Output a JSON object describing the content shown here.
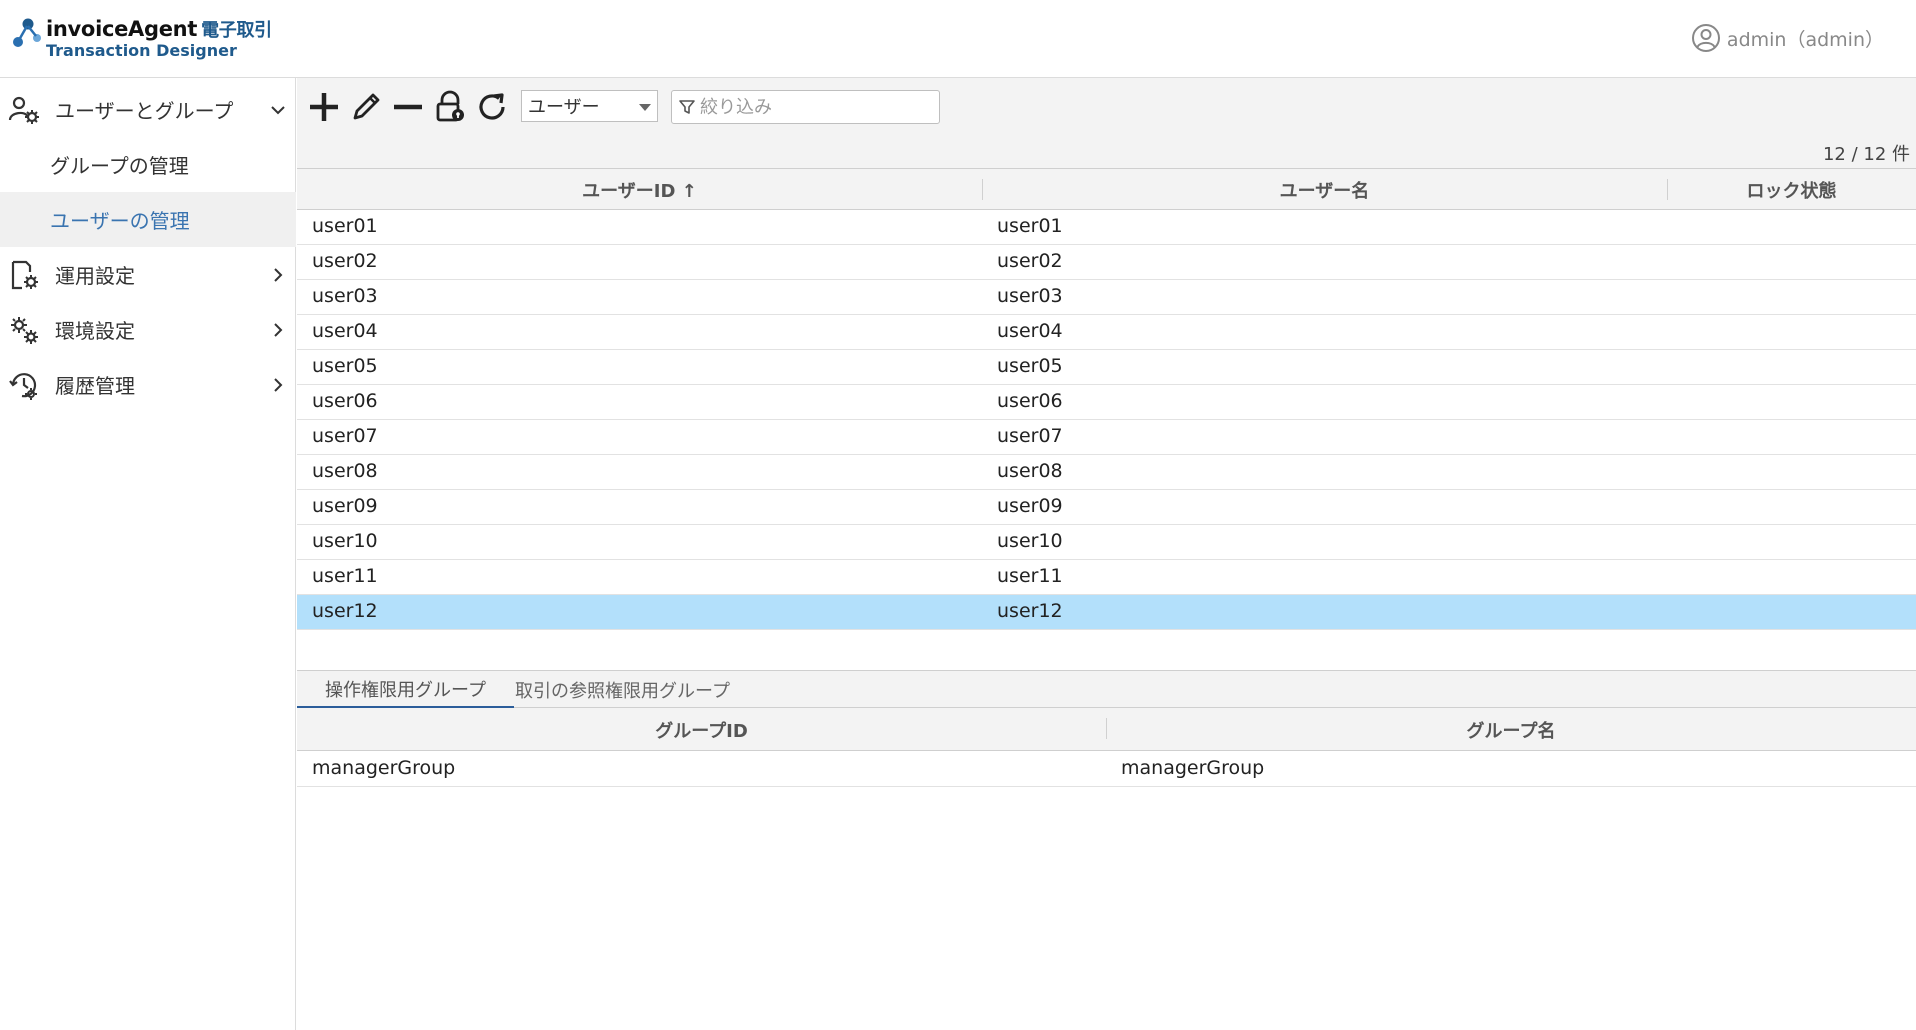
{
  "header": {
    "logo_name": "invoiceAgent",
    "logo_jp": "電子取引",
    "logo_sub": "Transaction Designer",
    "user_label": "admin（admin）"
  },
  "sidebar": {
    "sections": [
      {
        "label": "ユーザーとグループ",
        "icon": "user-gear-icon",
        "expanded": true
      },
      {
        "label": "運用設定",
        "icon": "document-gear-icon"
      },
      {
        "label": "環境設定",
        "icon": "gears-icon"
      },
      {
        "label": "履歴管理",
        "icon": "history-gear-icon"
      }
    ],
    "sub_items": [
      "グループの管理",
      "ユーザーの管理"
    ],
    "active_sub": "ユーザーの管理"
  },
  "toolbar": {
    "select_value": "ユーザー",
    "filter_placeholder": "絞り込み"
  },
  "count_text": "12 / 12 件",
  "users_table": {
    "columns": [
      "ユーザーID ↑",
      "ユーザー名",
      "ロック状態"
    ],
    "rows": [
      [
        "user01",
        "user01"
      ],
      [
        "user02",
        "user02"
      ],
      [
        "user03",
        "user03"
      ],
      [
        "user04",
        "user04"
      ],
      [
        "user05",
        "user05"
      ],
      [
        "user06",
        "user06"
      ],
      [
        "user07",
        "user07"
      ],
      [
        "user08",
        "user08"
      ],
      [
        "user09",
        "user09"
      ],
      [
        "user10",
        "user10"
      ],
      [
        "user11",
        "user11"
      ],
      [
        "user12",
        "user12"
      ]
    ],
    "selected_row": 12
  },
  "tabs": [
    "操作権限用グループ",
    "取引の参照権限用グループ"
  ],
  "groups_table": {
    "columns": [
      "グループID",
      "グループ名"
    ],
    "rows": [
      [
        "managerGroup",
        "managerGroup"
      ]
    ]
  },
  "colors": {
    "selected_row": "#b3e0fb",
    "accent": "#3a74b0",
    "logo_blue": "#1f5a8c"
  }
}
